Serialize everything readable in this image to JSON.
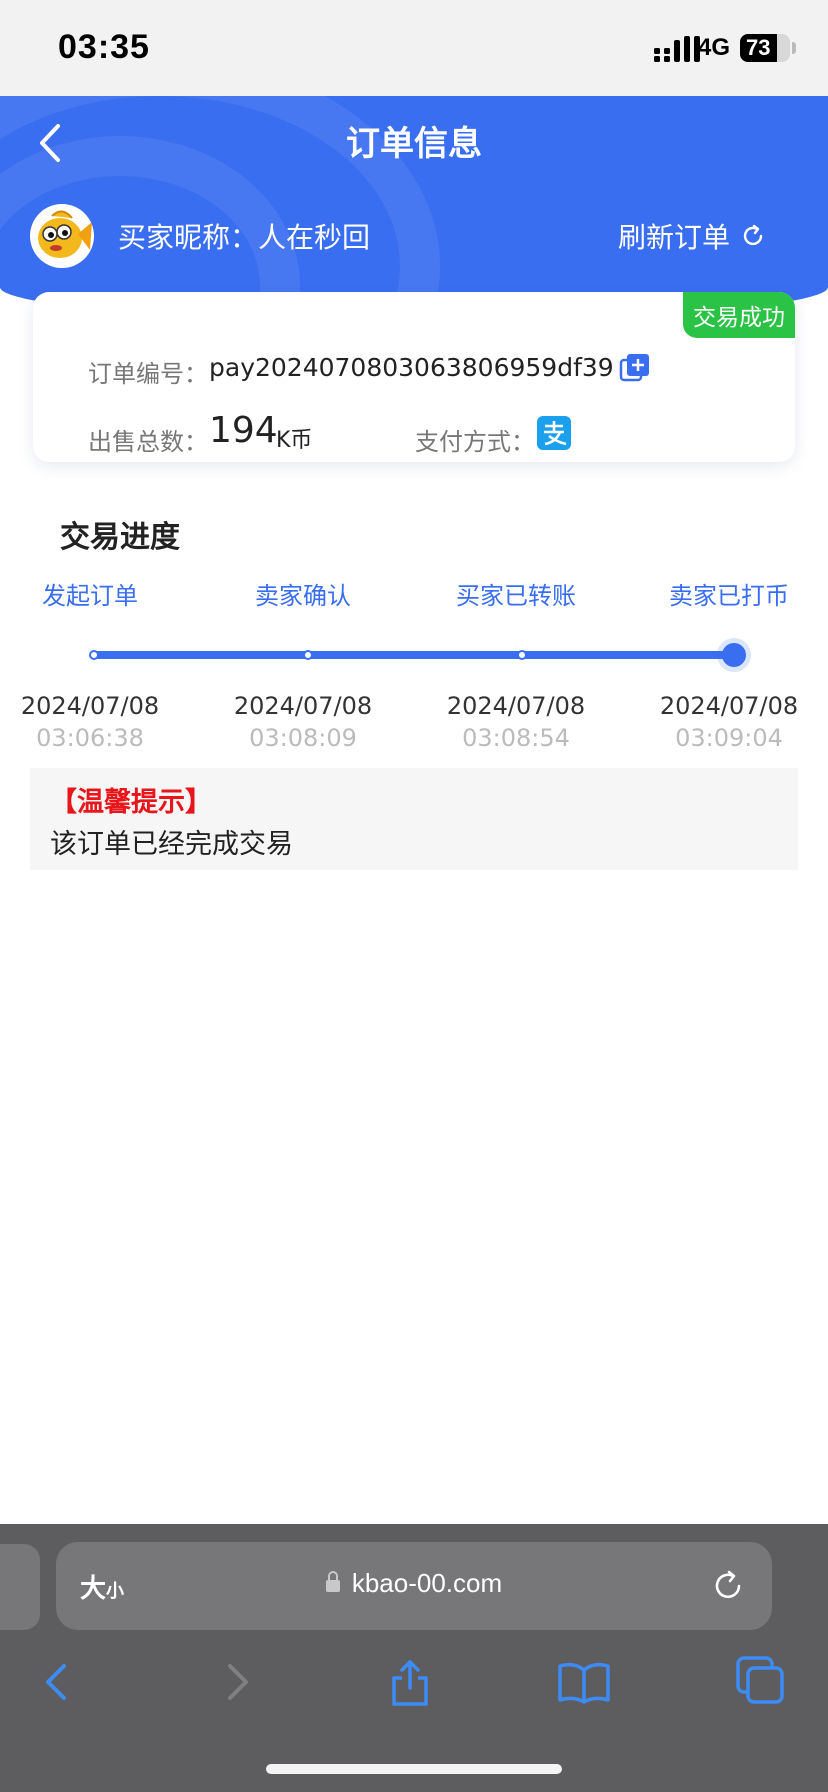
{
  "status_bar": {
    "time": "03:35",
    "network": "4G",
    "battery": "73"
  },
  "header": {
    "title": "订单信息",
    "buyer_label": "买家昵称：",
    "buyer_name": "人在秒回",
    "refresh_label": "刷新订单"
  },
  "order": {
    "status_badge": "交易成功",
    "id_label": "订单编号：",
    "id_value": "pay2024070803063806959df39",
    "qty_label": "出售总数：",
    "qty_value": "194",
    "qty_unit": "K币",
    "payment_label": "支付方式："
  },
  "progress": {
    "title": "交易进度",
    "steps": [
      {
        "label": "发起订单",
        "date": "2024/07/08",
        "time": "03:06:38"
      },
      {
        "label": "卖家确认",
        "date": "2024/07/08",
        "time": "03:08:09"
      },
      {
        "label": "买家已转账",
        "date": "2024/07/08",
        "time": "03:08:54"
      },
      {
        "label": "卖家已打币",
        "date": "2024/07/08",
        "time": "03:09:04"
      }
    ]
  },
  "tip": {
    "title": "【温馨提示】",
    "text": "该订单已经完成交易"
  },
  "browser": {
    "text_size_big": "大",
    "text_size_small": "小",
    "url": "kbao-00.com"
  },
  "colors": {
    "brand_blue": "#3a6ef0",
    "success_green": "#2bc346",
    "warning_red": "#e8151b"
  }
}
